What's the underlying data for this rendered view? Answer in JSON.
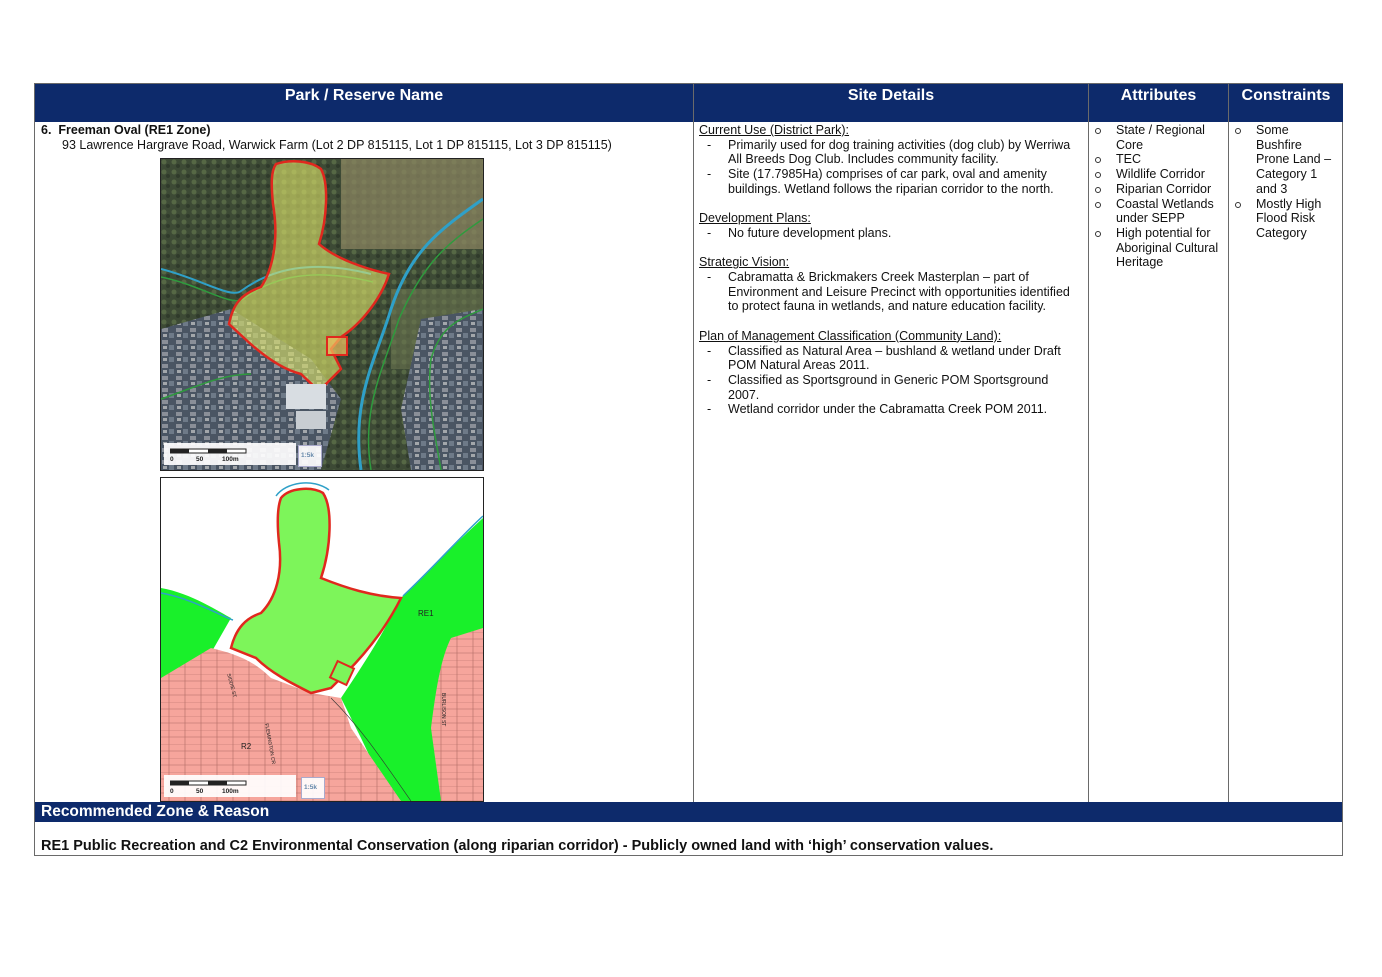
{
  "table": {
    "headers": {
      "park": "Park / Reserve Name",
      "site": "Site Details",
      "attributes": "Attributes",
      "constraints": "Constraints"
    },
    "park": {
      "number": "6.",
      "name": "Freeman Oval (RE1 Zone)",
      "address": "93 Lawrence Hargrave Road, Warwick Farm (Lot 2 DP 815115, Lot 1 DP 815115, Lot 3 DP 815115)"
    },
    "maps": {
      "aerial_scale": {
        "zero": "0",
        "fifty": "50",
        "hundred": "100m",
        "stamp": "1:5k"
      },
      "zoning_scale": {
        "zero": "0",
        "fifty": "50",
        "hundred": "100m",
        "stamp": "1:5k"
      },
      "zoning_labels": {
        "re1": "RE1",
        "r2": "R2",
        "street1": "BURLISON ST",
        "street2": "SIDDIE ST",
        "street3": "FLEMINGTON CR"
      }
    },
    "site_details": {
      "current_use_title": "Current Use (District Park):",
      "current_use": [
        "Primarily used for dog training activities (dog club) by Werriwa All Breeds Dog Club. Includes community facility.",
        "Site (17.7985Ha) comprises of car park, oval and amenity buildings. Wetland follows the riparian corridor to the north."
      ],
      "development_title": "Development Plans:",
      "development": [
        "No future development plans."
      ],
      "vision_title": "Strategic Vision:",
      "vision": [
        "Cabramatta & Brickmakers Creek Masterplan – part of Environment and Leisure Precinct with opportunities identified to protect fauna in wetlands, and nature education facility."
      ],
      "pom_title": "Plan of Management Classification (Community Land):",
      "pom": [
        "Classified as Natural Area – bushland & wetland under Draft POM Natural Areas 2011.",
        "Classified as Sportsground in Generic POM Sportsground 2007.",
        "Wetland corridor under the Cabramatta Creek POM 2011."
      ]
    },
    "attributes": [
      "State / Regional Core",
      "TEC",
      "Wildlife Corridor",
      "Riparian Corridor",
      "Coastal Wetlands under SEPP",
      "High potential for Aboriginal Cultural Heritage"
    ],
    "constraints": [
      "Some Bushfire Prone Land – Category 1 and 3",
      "Mostly High Flood Risk Category"
    ]
  },
  "recommendation": {
    "title": "Recommended Zone & Reason",
    "text": "RE1 Public Recreation and C2 Environmental Conservation (along riparian corridor) - Publicly owned land with ‘high’ conservation values."
  },
  "colors": {
    "header_bg": "#0d2a6b",
    "zone_re1": "#7df55a",
    "zone_c2": "#19f02a",
    "zone_r2": "#f6a59c",
    "boundary": "#e0281e"
  }
}
